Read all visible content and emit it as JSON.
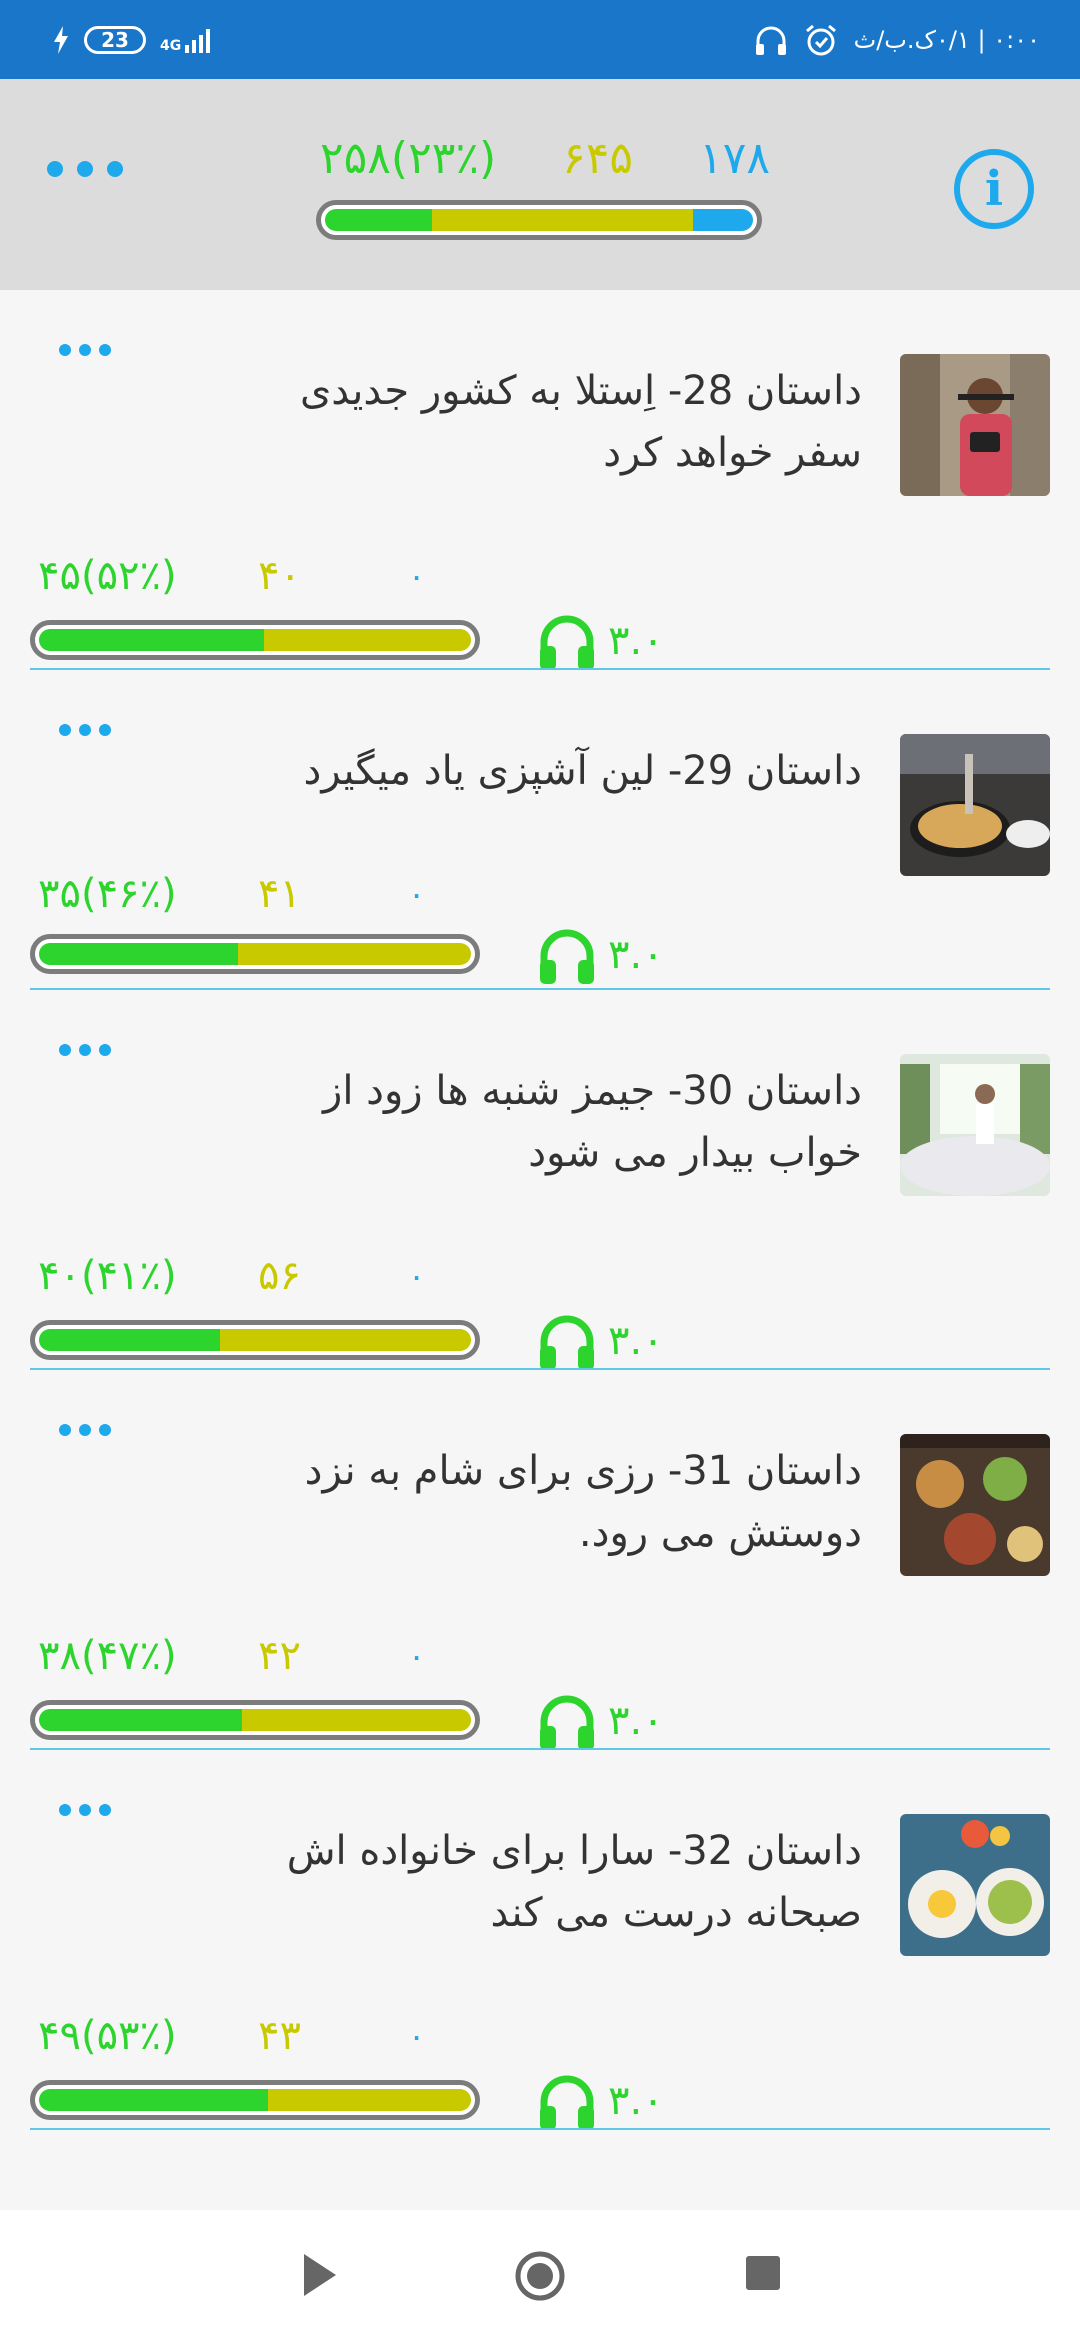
{
  "status_bar": {
    "battery_level": "23",
    "network": "4G",
    "time": "۰:۰۰ | ۰/۱ک.ب/ث"
  },
  "header": {
    "counts": {
      "known": "۲۵۸(۲۳٪)",
      "learning": "۶۴۵",
      "new": "۱۷۸"
    },
    "progress": {
      "green": 0.23,
      "yellow": 0.56,
      "blue": 0.13
    },
    "colors": {
      "known": "#2dd42d",
      "learning": "#c9c900",
      "new": "#1ea9ec"
    }
  },
  "stories": [
    {
      "title": "داستان 28- اِستلا به کشور جدیدی سفر خواهد کرد",
      "known": "۴۵(۵۲٪)",
      "learning": "۴۰",
      "new": "۰",
      "rating": "۳.۰",
      "progress": {
        "green": 0.52,
        "yellow": 0.48
      },
      "thumbnail": "traveler-with-camera"
    },
    {
      "title": "داستان 29- لین آشپزی یاد میگیرد",
      "known": "۳۵(۴۶٪)",
      "learning": "۴۱",
      "new": "۰",
      "rating": "۳.۰",
      "progress": {
        "green": 0.46,
        "yellow": 0.54
      },
      "thumbnail": "cooking-pan"
    },
    {
      "title": "داستان 30- جیمز شنبه ها زود از خواب بیدار می شود",
      "known": "۴۰(۴۱٪)",
      "learning": "۵۶",
      "new": "۰",
      "rating": "۳.۰",
      "progress": {
        "green": 0.42,
        "yellow": 0.58
      },
      "thumbnail": "morning-window"
    },
    {
      "title": "داستان 31- رزی برای شام به نزد دوستش می رود.",
      "known": "۳۸(۴۷٪)",
      "learning": "۴۲",
      "new": "۰",
      "rating": "۳.۰",
      "progress": {
        "green": 0.47,
        "yellow": 0.53
      },
      "thumbnail": "dinner-table"
    },
    {
      "title": "داستان 32- سارا برای خانواده اش صبحانه درست می کند",
      "known": "۴۹(۵۳٪)",
      "learning": "۴۳",
      "new": "۰",
      "rating": "۳.۰",
      "progress": {
        "green": 0.53,
        "yellow": 0.47
      },
      "thumbnail": "breakfast-plates"
    }
  ]
}
